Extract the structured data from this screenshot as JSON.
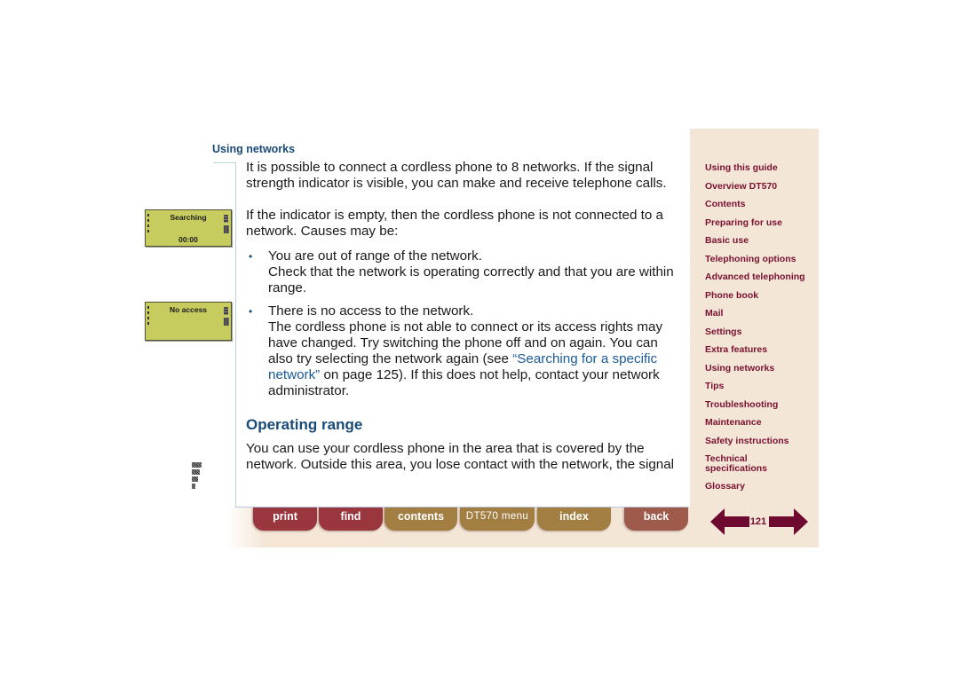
{
  "section_title": "Using networks",
  "content": {
    "paragraph1": "It is possible to connect a cordless phone to 8 networks. If the signal strength indicator is visible, you can make and receive telephone calls.",
    "paragraph2": "If the indicator is empty, then the cordless phone is not connected to a network. Causes may be:",
    "bullets": [
      {
        "marker": "•",
        "lead": "You are out of range of the network.",
        "detail": "Check that the network is operating correctly and that you are within range."
      },
      {
        "marker": "•",
        "lead": "There is no access to the network.",
        "detail_before_link": "The cordless phone is not able to connect or its access rights may have changed. Try switching the phone off and on again. You can also try selecting the network again (see ",
        "link_text": "“Searching for a specific network”",
        "detail_after_link": " on page 125). If this does not help, contact your network administrator."
      }
    ],
    "heading": "Operating range",
    "paragraph3": "You can use your cordless phone in the area that is covered by the network. Outside this area, you lose contact with the network, the signal"
  },
  "lcd_screens": [
    {
      "title": "Searching",
      "time": "00:00"
    },
    {
      "title": "No access",
      "time": ""
    }
  ],
  "nav_buttons": [
    {
      "id": "print",
      "label": "print"
    },
    {
      "id": "find",
      "label": "find"
    },
    {
      "id": "contents",
      "label": "contents"
    },
    {
      "id": "dt570-menu",
      "label": "DT570 menu"
    },
    {
      "id": "index",
      "label": "index"
    },
    {
      "id": "back",
      "label": "back"
    }
  ],
  "sidebar": {
    "items": [
      "Using this guide",
      "Overview DT570",
      "Contents",
      "Preparing for use",
      "Basic use",
      "Telephoning options",
      "Advanced telephoning",
      "Phone book",
      "Mail",
      "Settings",
      "Extra features",
      "Using networks",
      "Tips",
      "Troubleshooting",
      "Maintenance",
      "Safety instructions",
      "Technical specifications",
      "Glossary"
    ]
  },
  "pager": {
    "page_number": "121"
  },
  "colors": {
    "heading_blue": "#1a4a78",
    "link_blue": "#1a5a98",
    "sidebar_text": "#7a1030",
    "sidebar_bg": "#f3e6d6",
    "button_red": "#9a363d",
    "button_gold": "#a27e42",
    "lcd_green": "#c6cc5e"
  }
}
